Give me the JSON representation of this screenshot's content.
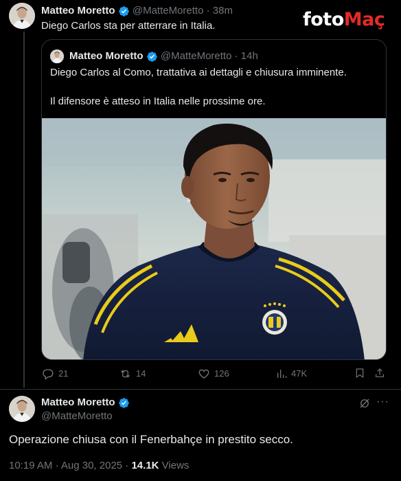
{
  "watermark": {
    "part1": "foto",
    "part2": "Maç"
  },
  "tweet": {
    "author_name": "Matteo Moretto",
    "handle": "@MatteMoretto",
    "separator": "·",
    "time": "38m",
    "text": "Diego Carlos sta per atterrare in Italia.",
    "quote": {
      "author_name": "Matteo Moretto",
      "handle": "@MatteMoretto",
      "time": "14h",
      "text_line1": "Diego Carlos al Como, trattativa ai dettagli e chiusura imminente.",
      "text_line2": "Il difensore è atteso in Italia nelle prossime ore."
    },
    "stats": {
      "replies": "21",
      "reposts": "14",
      "likes": "126",
      "views": "47K"
    }
  },
  "main_tweet": {
    "author_name": "Matteo Moretto",
    "handle": "@MatteMoretto",
    "text": "Operazione chiusa con il Fenerbahçe in prestito secco.",
    "timestamp": "10:19 AM · Aug 30, 2025 · ",
    "views_count": "14.1K",
    "views_label": " Views",
    "more": "···"
  },
  "colors": {
    "background": "#000000",
    "text": "#e7e9ea",
    "muted": "#71767b",
    "verified": "#1d9bf0",
    "border": "#2f3336",
    "watermark_accent": "#e22b26"
  }
}
